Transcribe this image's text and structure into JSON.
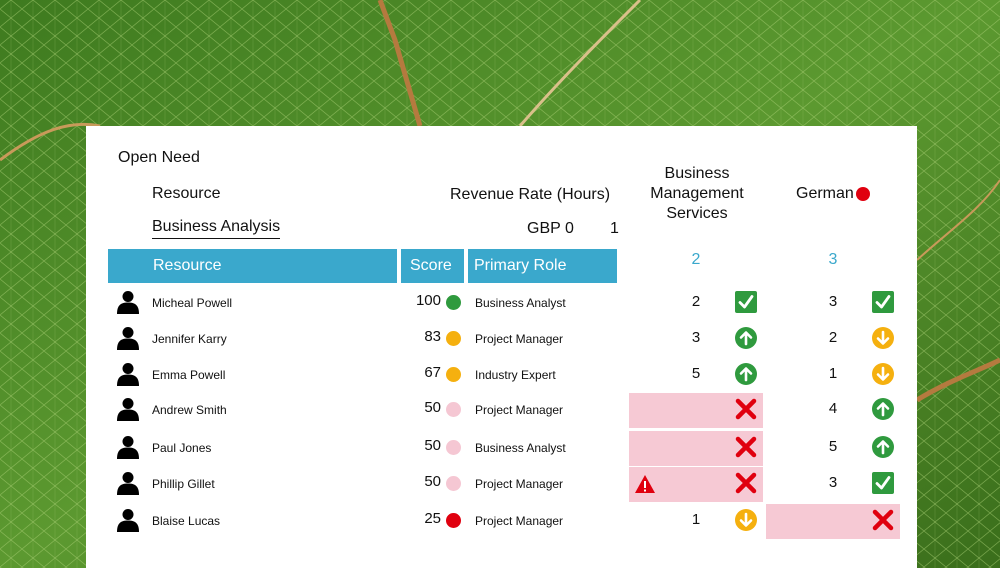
{
  "panel": {
    "open_need_label": "Open Need",
    "resource_label": "Resource",
    "revenue_rate_label": "Revenue Rate (Hours)",
    "resource_value": "Business Analysis",
    "revenue_rate_value": "GBP 0",
    "revenue_rate_count": "1"
  },
  "columns": {
    "requirement_a": "Business Management Services",
    "requirement_b": "German",
    "requirement_b_dot_color": "#e0000f",
    "count_a": "2",
    "count_b": "3"
  },
  "table": {
    "headers": {
      "resource": "Resource",
      "score": "Score",
      "role": "Primary Role"
    },
    "rows": [
      {
        "name": "Micheal Powell",
        "score": "100",
        "score_color": "#2f9a3e",
        "role": "Business Analyst",
        "a": {
          "value": "2",
          "icon": "check-icon",
          "highlight": false,
          "warning": false
        },
        "b": {
          "value": "3",
          "icon": "check-icon",
          "highlight": false
        }
      },
      {
        "name": "Jennifer Karry",
        "score": "83",
        "score_color": "#f5b00f",
        "role": "Project Manager",
        "a": {
          "value": "3",
          "icon": "arrow-up-icon",
          "highlight": false,
          "warning": false
        },
        "b": {
          "value": "2",
          "icon": "arrow-down-icon",
          "highlight": false
        }
      },
      {
        "name": "Emma Powell",
        "score": "67",
        "score_color": "#f5b00f",
        "role": "Industry Expert",
        "a": {
          "value": "5",
          "icon": "arrow-up-icon",
          "highlight": false,
          "warning": false
        },
        "b": {
          "value": "1",
          "icon": "arrow-down-icon",
          "highlight": false
        }
      },
      {
        "name": "Andrew Smith",
        "score": "50",
        "score_color": "#f5c7d3",
        "role": "Project Manager",
        "a": {
          "value": "",
          "icon": "cross-icon",
          "highlight": true,
          "warning": false
        },
        "b": {
          "value": "4",
          "icon": "arrow-up-icon",
          "highlight": false
        }
      },
      {
        "name": "Paul Jones",
        "score": "50",
        "score_color": "#f5c7d3",
        "role": "Business Analyst",
        "a": {
          "value": "",
          "icon": "cross-icon",
          "highlight": true,
          "warning": false
        },
        "b": {
          "value": "5",
          "icon": "arrow-up-icon",
          "highlight": false
        }
      },
      {
        "name": "Phillip Gillet",
        "score": "50",
        "score_color": "#f5c7d3",
        "role": "Project Manager",
        "a": {
          "value": "",
          "icon": "cross-icon",
          "highlight": true,
          "warning": true
        },
        "b": {
          "value": "3",
          "icon": "check-icon",
          "highlight": false
        }
      },
      {
        "name": "Blaise Lucas",
        "score": "25",
        "score_color": "#e0000f",
        "role": "Project Manager",
        "a": {
          "value": "1",
          "icon": "arrow-down-icon",
          "highlight": false,
          "warning": false
        },
        "b": {
          "value": "",
          "icon": "cross-icon",
          "highlight": true
        }
      }
    ]
  },
  "colors": {
    "header": "#3aa8cc",
    "check": "#2f9a3e",
    "arrow_up": "#2f9a3e",
    "arrow_down": "#f5b00f",
    "cross": "#e0000f",
    "mismatch_bg": "#f6c9d4"
  }
}
